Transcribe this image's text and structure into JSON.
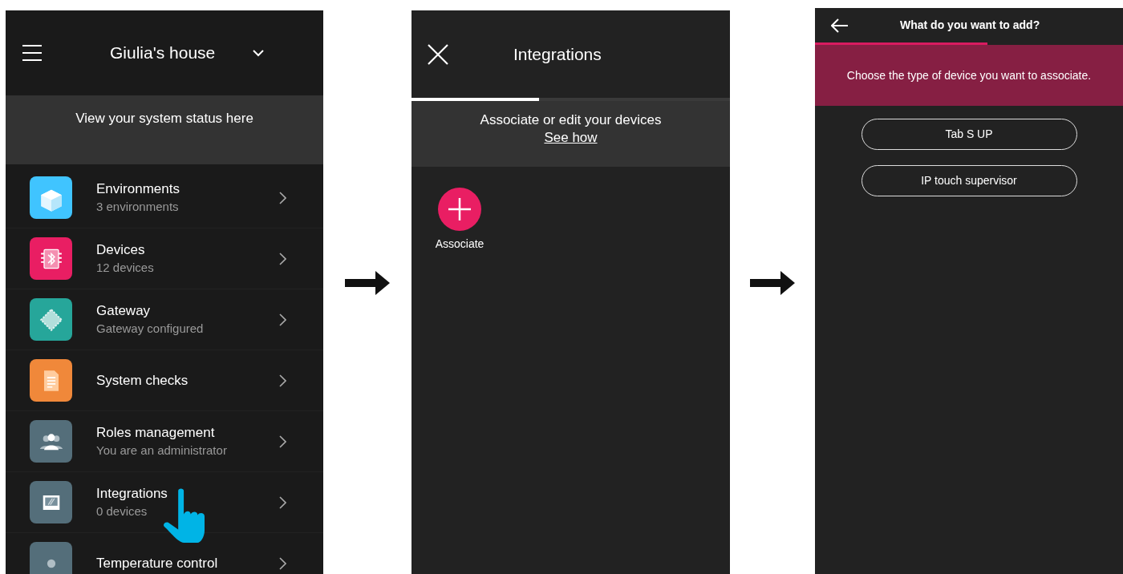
{
  "screen_1": {
    "title": "Giulia's house",
    "banner": "View your system status here",
    "items": [
      {
        "kind": "cube",
        "color": "#40c4ff",
        "title": "Environments",
        "subtitle": "3 environments"
      },
      {
        "kind": "chip",
        "color": "#e91e63",
        "title": "Devices",
        "subtitle": "12 devices"
      },
      {
        "kind": "gateway",
        "color": "#26a69a",
        "title": "Gateway",
        "subtitle": "Gateway configured"
      },
      {
        "kind": "document",
        "color": "#f0883a",
        "title": "System checks"
      },
      {
        "kind": "people",
        "color": "#546e7a",
        "title": "Roles management",
        "subtitle": "You are an administrator"
      },
      {
        "kind": "screen",
        "color": "#546e7a",
        "title": "Integrations",
        "subtitle": "0 devices",
        "tapped": true
      },
      {
        "kind": "thermo",
        "color": "#546e7a",
        "title": "Temperature control"
      }
    ]
  },
  "screen_2": {
    "title": "Integrations",
    "progress": {
      "level": 0.4
    },
    "banner": "Associate or edit your devices",
    "link": "See how",
    "action": "Associate"
  },
  "screen_3": {
    "title": "What do you want to add?",
    "progress": {
      "level": 0.56
    },
    "banner": "Choose the type of device you want to associate.",
    "options": [
      "Tab S UP",
      "IP touch supervisor"
    ]
  }
}
